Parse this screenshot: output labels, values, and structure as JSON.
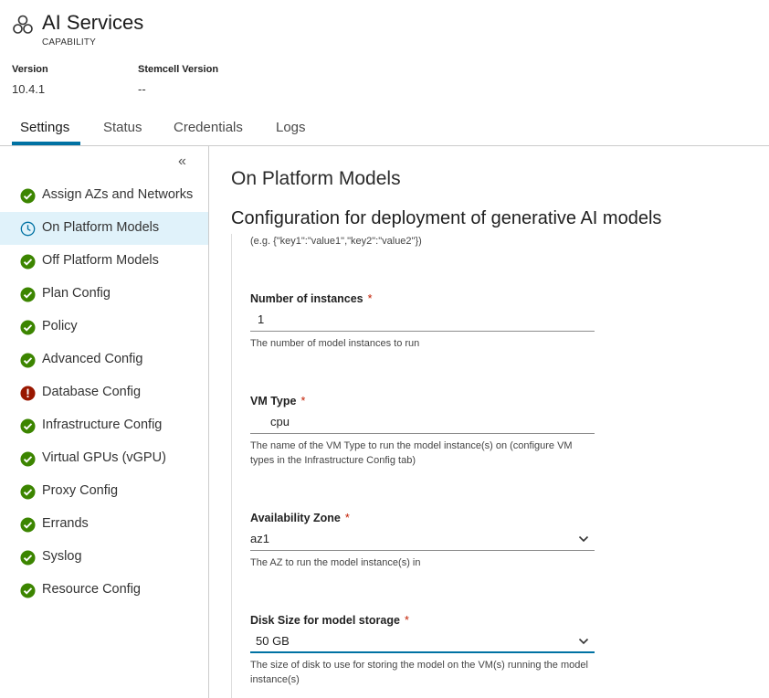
{
  "header": {
    "title": "AI Services",
    "subtitle": "CAPABILITY",
    "version_label": "Version",
    "version_value": "10.4.1",
    "stemcell_label": "Stemcell Version",
    "stemcell_value": "--"
  },
  "tabs": [
    {
      "label": "Settings",
      "active": true
    },
    {
      "label": "Status"
    },
    {
      "label": "Credentials"
    },
    {
      "label": "Logs"
    }
  ],
  "sidebar": {
    "collapse_icon": "«",
    "items": [
      {
        "label": "Assign AZs and Networks",
        "status": "complete"
      },
      {
        "label": "On Platform Models",
        "status": "in-progress"
      },
      {
        "label": "Off Platform Models",
        "status": "complete"
      },
      {
        "label": "Plan Config",
        "status": "complete"
      },
      {
        "label": "Policy",
        "status": "complete"
      },
      {
        "label": "Advanced Config",
        "status": "complete"
      },
      {
        "label": "Database Config",
        "status": "error"
      },
      {
        "label": "Infrastructure Config",
        "status": "complete"
      },
      {
        "label": "Virtual GPUs (vGPU)",
        "status": "complete"
      },
      {
        "label": "Proxy Config",
        "status": "complete"
      },
      {
        "label": "Errands",
        "status": "complete"
      },
      {
        "label": "Syslog",
        "status": "complete"
      },
      {
        "label": "Resource Config",
        "status": "complete"
      }
    ]
  },
  "main": {
    "page_title": "On Platform Models",
    "section_title": "Configuration for deployment of generative AI models",
    "top_hint": "(e.g. {\"key1\":\"value1\",\"key2\":\"value2\"})",
    "fields": {
      "instances": {
        "label": "Number of instances",
        "required": "*",
        "value": "1",
        "hint": "The number of model instances to run"
      },
      "vm_type": {
        "label": "VM Type",
        "required": "*",
        "value": "cpu",
        "hint": "The name of the VM Type to run the model instance(s) on (configure VM types in the Infrastructure Config tab)"
      },
      "az": {
        "label": "Availability Zone",
        "required": "*",
        "value": "az1",
        "hint": "The AZ to run the model instance(s) in"
      },
      "disk": {
        "label": "Disk Size for model storage",
        "required": "*",
        "value": "50 GB",
        "hint": "The size of disk to use for storing the model on the VM(s) running the model instance(s)"
      }
    }
  },
  "colors": {
    "accent": "#0072a3",
    "success": "#3c8500",
    "error": "#991700",
    "active_bg": "#e0f2fa",
    "required": "#c21d00"
  },
  "icons": {
    "app": "hexagon-cluster-icon",
    "complete": "check-circle-icon",
    "in_progress": "clock-icon",
    "error": "exclamation-circle-icon",
    "select": "chevron-down-icon"
  }
}
